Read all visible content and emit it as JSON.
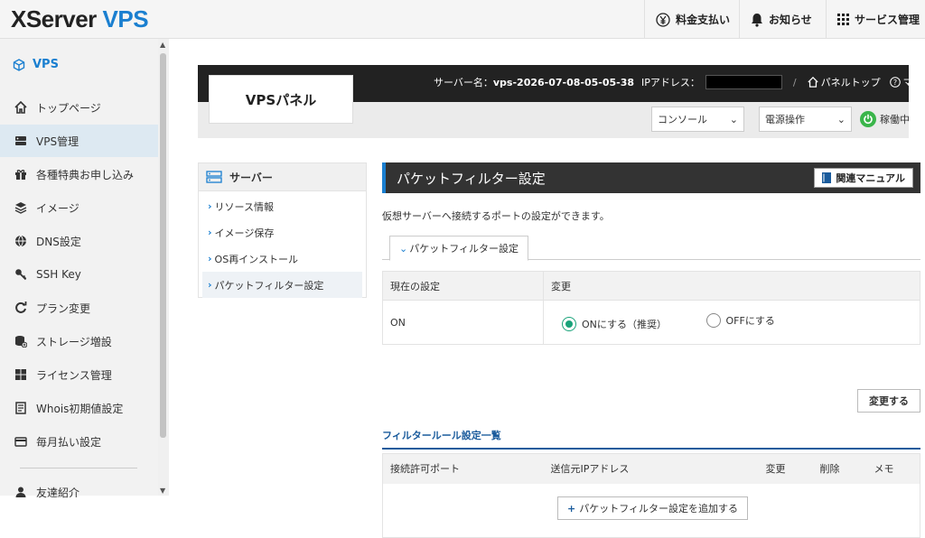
{
  "brand": {
    "name": "XServer",
    "product": "VPS"
  },
  "topnav": [
    {
      "label": "料金支払い",
      "icon": "yen-icon"
    },
    {
      "label": "お知らせ",
      "icon": "bell-icon"
    },
    {
      "label": "サービス管理",
      "icon": "grid-icon"
    }
  ],
  "sidebar": {
    "header": "VPS",
    "items": [
      {
        "label": "トップページ",
        "icon": "home-icon"
      },
      {
        "label": "VPS管理",
        "icon": "server-icon",
        "active": true
      },
      {
        "label": "各種特典お申し込み",
        "icon": "gift-icon"
      },
      {
        "label": "イメージ",
        "icon": "layers-icon"
      },
      {
        "label": "DNS設定",
        "icon": "globe-icon"
      },
      {
        "label": "SSH Key",
        "icon": "key-icon"
      },
      {
        "label": "プラン変更",
        "icon": "refresh-icon"
      },
      {
        "label": "ストレージ増設",
        "icon": "storage-icon"
      },
      {
        "label": "ライセンス管理",
        "icon": "windows-icon"
      },
      {
        "label": "Whois初期値設定",
        "icon": "document-icon"
      },
      {
        "label": "毎月払い設定",
        "icon": "card-icon"
      },
      {
        "label": "友達紹介",
        "icon": "user-icon"
      }
    ]
  },
  "panel": {
    "title": "VPSパネル",
    "server_label": "サーバー名：",
    "server_name": "vps-2026-07-08-05-05-38",
    "ip_label": "IPアドレス：",
    "separator": "/",
    "top_link": "パネルトップ",
    "manual_link": "マニュアル",
    "console": "コンソール",
    "power": "電源操作",
    "status": "稼働中"
  },
  "submenu": {
    "header": "サーバー",
    "items": [
      "リソース情報",
      "イメージ保存",
      "OS再インストール",
      "パケットフィルター設定"
    ]
  },
  "content": {
    "title": "パケットフィルター設定",
    "manual_button": "関連マニュアル",
    "description": "仮想サーバーへ接続するポートの設定ができます。",
    "tab": "パケットフィルター設定",
    "current_header": "現在の設定",
    "change_header": "変更",
    "current_value": "ON",
    "radio_on": "ONにする（推奨）",
    "radio_off": "OFFにする",
    "change_button": "変更する",
    "rules_title": "フィルタールール設定一覧",
    "rule_columns": [
      "接続許可ポート",
      "送信元IPアドレス",
      "変更",
      "削除",
      "メモ"
    ],
    "add_button": "パケットフィルター設定を追加する"
  },
  "colors": {
    "accent": "#1a7fd0",
    "status_green": "#3ab54a",
    "radio_green": "#1aa37a"
  }
}
